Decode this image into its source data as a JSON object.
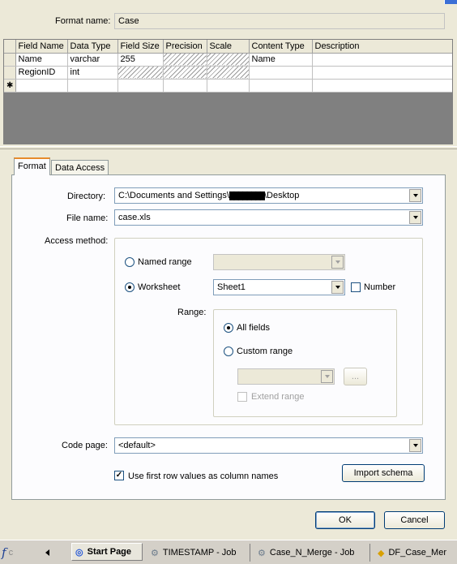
{
  "format_name": {
    "label": "Format name:",
    "value": "Case"
  },
  "grid": {
    "columns": [
      "Field Name",
      "Data Type",
      "Field Size",
      "Precision",
      "Scale",
      "Content Type",
      "Description"
    ],
    "rows": [
      {
        "field_name": "Name",
        "data_type": "varchar",
        "field_size": "255",
        "precision": "",
        "scale": "",
        "content_type": "Name",
        "description": ""
      },
      {
        "field_name": "RegionID",
        "data_type": "int",
        "field_size": "",
        "precision": "",
        "scale": "",
        "content_type": "",
        "description": ""
      }
    ],
    "new_row_marker": "✱"
  },
  "tabs": [
    "Format",
    "Data Access"
  ],
  "directory": {
    "label": "Directory:",
    "value_before": "C:\\Documents and Settings\\",
    "value_redacted": "████████",
    "value_after": "\\Desktop"
  },
  "file_name": {
    "label": "File name:",
    "value": "case.xls"
  },
  "access_method": {
    "label": "Access method:",
    "named_range_label": "Named range",
    "worksheet_label": "Worksheet",
    "worksheet_value": "Sheet1",
    "number_label": "Number",
    "selected": "Worksheet"
  },
  "range": {
    "label": "Range:",
    "all_fields_label": "All fields",
    "custom_range_label": "Custom range",
    "ellipsis_label": "...",
    "extend_range_label": "Extend range",
    "selected": "All fields"
  },
  "code_page": {
    "label": "Code page:",
    "value": "<default>"
  },
  "first_row_checkbox": {
    "label": "Use first row values as column names",
    "checked": true
  },
  "buttons": {
    "import_schema": "Import schema",
    "ok": "OK",
    "cancel": "Cancel"
  },
  "taskbar": {
    "items": [
      {
        "label": "Start Page",
        "active": true
      },
      {
        "label": "TIMESTAMP - Job",
        "active": false
      },
      {
        "label": "Case_N_Merge - Job",
        "active": false
      },
      {
        "label": "DF_Case_Mer",
        "active": false
      }
    ]
  },
  "colors": {
    "tab_highlight": "#e68b2c",
    "grid_empty": "#808080",
    "accent_blue": "#3b6fd6"
  }
}
